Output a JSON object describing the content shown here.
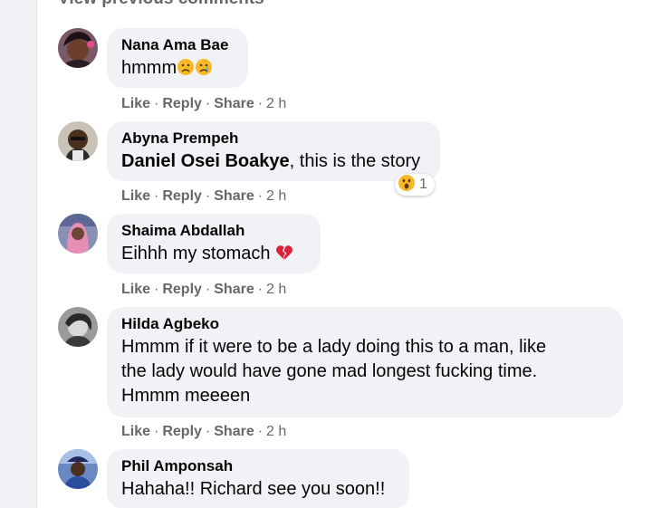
{
  "view_previous_label": "View previous comments",
  "comments": [
    {
      "author": "Nana Ama Bae",
      "text": "hmmm",
      "emojis": [
        "frowning-face-emoji",
        "crying-face-emoji"
      ],
      "actions": {
        "like": "Like",
        "reply": "Reply",
        "share": "Share",
        "time": "2 h"
      }
    },
    {
      "author": "Abyna Prempeh",
      "mention": "Daniel Osei Boakye",
      "text": ", this is the story",
      "reaction": {
        "icon": "wow-reaction-icon",
        "count": "1"
      },
      "actions": {
        "like": "Like",
        "reply": "Reply",
        "share": "Share",
        "time": "2 h"
      }
    },
    {
      "author": "Shaima Abdallah",
      "text": "Eihhh my stomach",
      "emojis": [
        "broken-heart-emoji"
      ],
      "actions": {
        "like": "Like",
        "reply": "Reply",
        "share": "Share",
        "time": "2 h"
      }
    },
    {
      "author": "Hilda Agbeko",
      "text_lines": [
        "Hmmm if it were to be a lady doing this to a man, like",
        "the lady would have gone mad longest fucking time.",
        "Hmmm meeeen"
      ],
      "actions": {
        "like": "Like",
        "reply": "Reply",
        "share": "Share",
        "time": "2 h"
      }
    },
    {
      "author": "Phil Amponsah",
      "text": "Hahaha!! Richard see you soon!!"
    }
  ],
  "separator": "·",
  "colors": {
    "bubble": "#f0f2f5",
    "secondary_text": "#65676b",
    "primary_text": "#050505"
  }
}
